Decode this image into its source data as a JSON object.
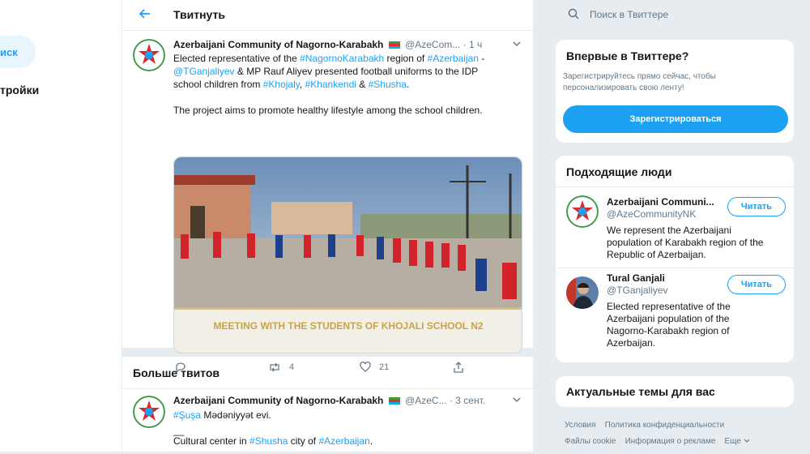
{
  "leftnav": {
    "search_label": "иск",
    "settings_label": "тройки"
  },
  "header": {
    "title": "Твитнуть"
  },
  "tweet1": {
    "name": "Azerbaijani Community of Nagorno-Karabakh",
    "handle": "@AzeCom...",
    "time": "· 1 ч",
    "line1": [
      "Elected representative of the ",
      "#NagornoKarabakh",
      " region of ",
      "#Azerbaijan",
      " -"
    ],
    "line2": [
      "@TGanjaliyev",
      " & MP Rauf Aliyev presented football uniforms to the IDP"
    ],
    "line3": [
      "school children from ",
      "#Khojaly",
      ", ",
      "#Khankendi",
      " & ",
      "#Shusha",
      "."
    ],
    "line4": "The project aims to promote healthy lifestyle among the school children.",
    "media_caption": "MEETING WITH THE STUDENTS OF KHOJALI SCHOOL N2",
    "retweets": "4",
    "likes": "21"
  },
  "more_tweets": {
    "title": "Больше твитов"
  },
  "tweet2": {
    "name": "Azerbaijani Community of Nagorno-Karabakh",
    "handle": "@AzeC...",
    "time": "· 3 сент.",
    "line1": [
      "#Şuşa",
      " Mədəniyyət evi."
    ],
    "line2": "__",
    "line3": [
      "Cultural center in ",
      "#Shusha",
      " city of ",
      "#Azerbaijan",
      "."
    ]
  },
  "search": {
    "placeholder": "Поиск в Твиттере"
  },
  "new_card": {
    "title": "Впервые в Твиттере?",
    "text_line1": "Зарегистрируйтесь прямо сейчас, чтобы",
    "text_line2": "персонализировать свою ленту!",
    "button": "Зарегистрироваться"
  },
  "people_card": {
    "title": "Подходящие люди",
    "people": [
      {
        "name": "Azerbaijani Communi...",
        "handle": "@AzeCommunityNK",
        "follow": "Читать",
        "bio": [
          "We represent the Azerbaijani",
          "population of Karabakh region of the",
          "Republic of Azerbaijan."
        ]
      },
      {
        "name": "Tural Ganjali",
        "handle": "@TGanjaliyev",
        "follow": "Читать",
        "bio": [
          "Elected representative of the",
          "Azerbaijani population of the",
          "Nagorno-Karabakh region of",
          "Azerbaijan."
        ]
      }
    ]
  },
  "trends_card": {
    "title": "Актуальные темы для вас"
  },
  "footer": {
    "row1": [
      "Условия",
      "Политика конфиденциальности"
    ],
    "row2": [
      "Файлы cookie",
      "Информация о рекламе",
      "Еще"
    ]
  },
  "colors": {
    "accent": "#1da1f2",
    "bg": "#e6ecf0",
    "muted": "#657786"
  },
  "icons": [
    "back-arrow-icon",
    "search-icon",
    "chevron-down-icon",
    "reply-icon",
    "retweet-icon",
    "like-icon",
    "share-icon",
    "azerbaijan-flag-icon"
  ]
}
